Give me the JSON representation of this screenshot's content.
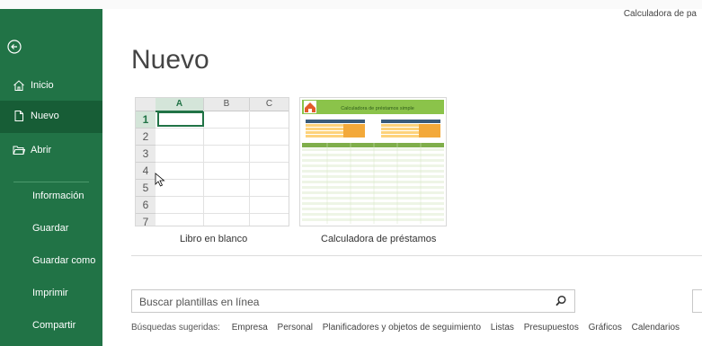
{
  "window": {
    "title": "Calculadora de pa"
  },
  "sidebar": {
    "back_icon": "circle-arrow-left-icon",
    "items": [
      {
        "label": "Inicio",
        "icon": "home-icon"
      },
      {
        "label": "Nuevo",
        "icon": "new-document-icon",
        "active": true
      },
      {
        "label": "Abrir",
        "icon": "folder-open-icon"
      }
    ],
    "sub_items": [
      {
        "label": "Información"
      },
      {
        "label": "Guardar"
      },
      {
        "label": "Guardar como"
      },
      {
        "label": "Imprimir"
      },
      {
        "label": "Compartir"
      }
    ],
    "bg_color": "#217346",
    "active_color": "#175d36"
  },
  "main": {
    "page_title": "Nuevo",
    "templates": [
      {
        "label": "Libro en blanco",
        "columns": [
          "A",
          "B",
          "C"
        ],
        "rows": [
          "1",
          "2",
          "3",
          "4",
          "5",
          "6",
          "7"
        ]
      },
      {
        "label": "Calculadora de préstamos",
        "banner_title": "Calculadora de préstamos simple"
      }
    ],
    "search": {
      "placeholder": "Buscar plantillas en línea",
      "icon": "search-icon"
    },
    "suggested": {
      "label": "Búsquedas sugeridas:",
      "links": [
        "Empresa",
        "Personal",
        "Planificadores y objetos de seguimiento",
        "Listas",
        "Presupuestos",
        "Gráficos",
        "Calendarios"
      ]
    }
  }
}
